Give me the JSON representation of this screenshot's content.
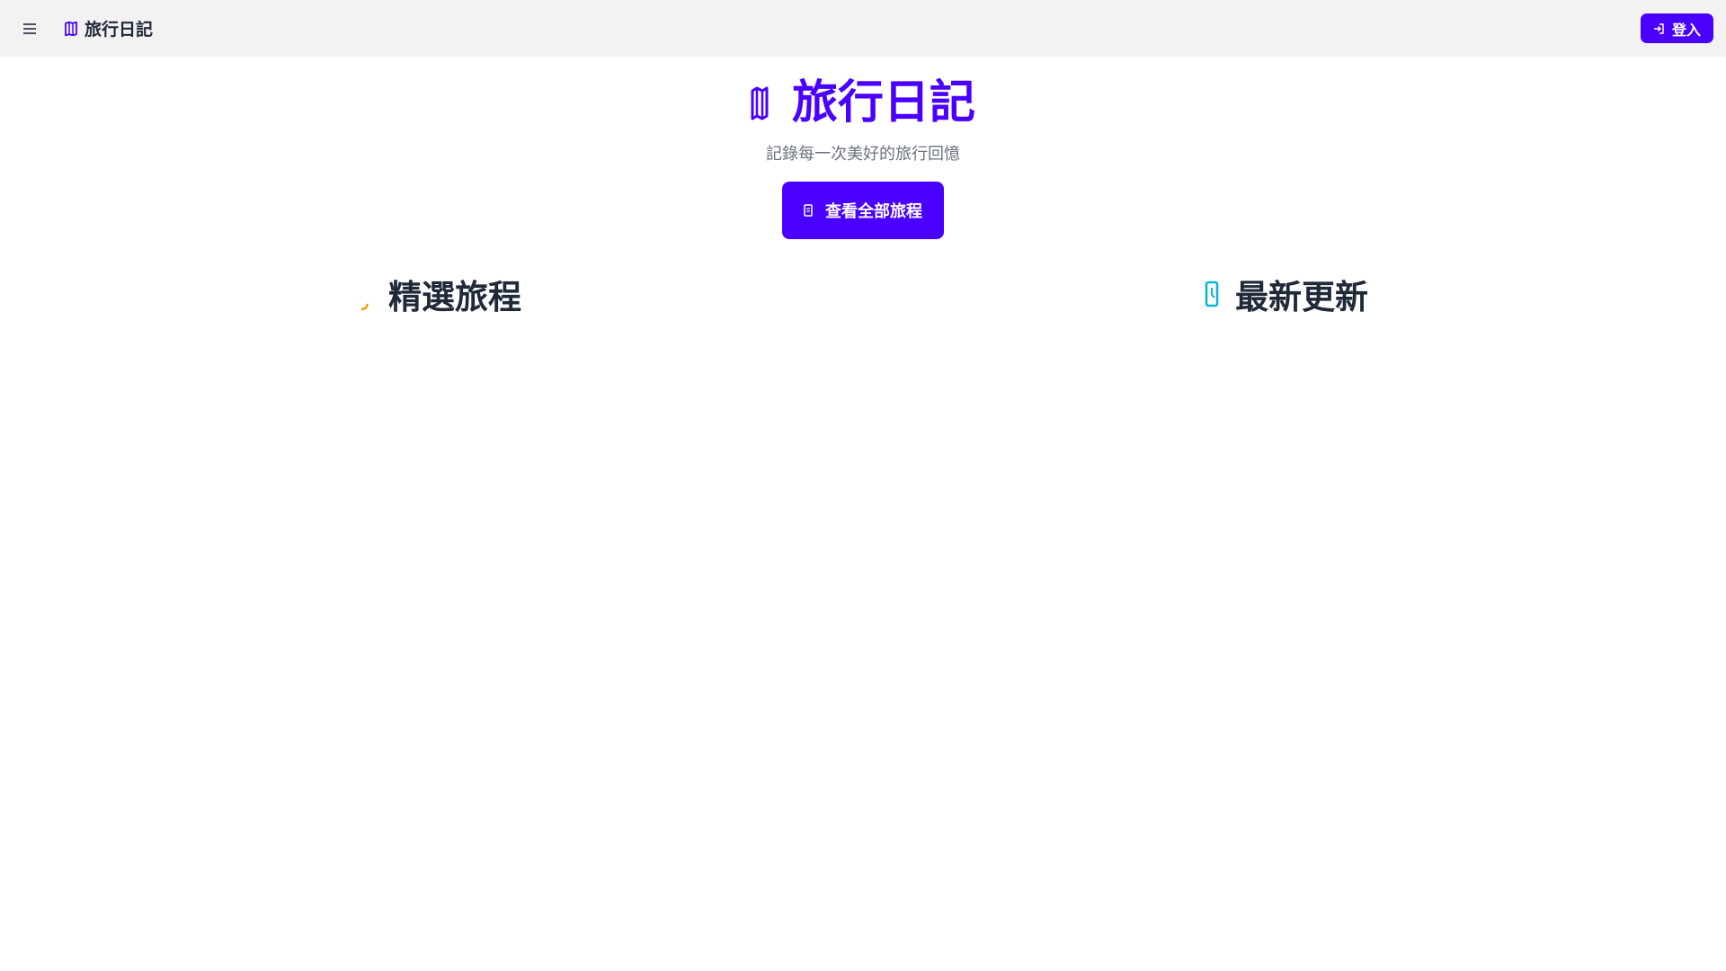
{
  "navbar": {
    "menu_icon": "hamburger-menu-icon",
    "brand": {
      "icon": "map-icon",
      "label": "旅行日記"
    },
    "login": {
      "icon": "login-icon",
      "label": "登入"
    }
  },
  "hero": {
    "icon": "map-icon",
    "title": "旅行日記",
    "subtitle": "記錄每一次美好的旅行回憶",
    "cta": {
      "icon": "list-icon",
      "label": "查看全部旅程"
    }
  },
  "sections": {
    "featured": {
      "icon": "star-icon",
      "title": "精選旅程"
    },
    "latest": {
      "icon": "clock-icon",
      "title": "最新更新"
    }
  },
  "colors": {
    "accent": "#4a00ff",
    "navbar_bg": "#f2f2f2",
    "featured_icon": "#f59e0b",
    "latest_icon": "#06b6d4",
    "subtitle": "#6b7280",
    "heading": "#1f2937"
  }
}
